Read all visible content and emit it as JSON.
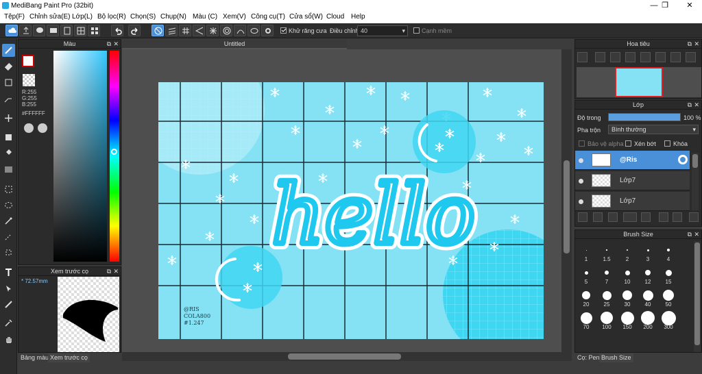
{
  "window": {
    "title": "MediBang Paint Pro (32bit)",
    "minimize": "—",
    "restore": "❐",
    "close": "✕"
  },
  "menu": [
    "Tệp(F)",
    "Chỉnh sửa(E)",
    "Lớp(L)",
    "Bộ lọc(R)",
    "Chọn(S)",
    "Chụp(N)",
    "Màu (C)",
    "Xem(V)",
    "Công cụ(T)",
    "Cửa sổ(W)",
    "Cloud",
    "Help"
  ],
  "toolbar": {
    "antialias_label": "Khử răng cưa",
    "correction_label": "Điều chỉnh",
    "correction_value": "40",
    "edge_label": "Cạnh mềm"
  },
  "color_panel": {
    "title": "Màu",
    "r": "R:255",
    "g": "G:255",
    "b": "B:255",
    "hex": "#FFFFFF",
    "fg_color": "#ffffff",
    "bg_color": "#ffffff"
  },
  "brush_preview": {
    "title": "Xem trước cọ",
    "size": "72.57mm"
  },
  "left_bottom_tabs": [
    "Bảng màu",
    "Xem trước cọ"
  ],
  "document": {
    "tab": "Untitled",
    "hello_text": "hello",
    "watermark_lines": [
      "@RIS",
      "COLA800",
      "#1.247"
    ]
  },
  "navigator": {
    "title": "Hoa tiêu"
  },
  "layers": {
    "title": "Lớp",
    "opacity_label": "Độ trong",
    "opacity_value": "100 %",
    "opacity": 1.0,
    "blend_label": "Pha trộn",
    "blend_value": "Bình thường",
    "protect_alpha": "Bảo vệ alpha",
    "clip": "Xén bớt",
    "lock": "Khóa",
    "items": [
      {
        "name": "@Ris",
        "selected": true
      },
      {
        "name": "Lớp7",
        "selected": false
      },
      {
        "name": "Lớp7",
        "selected": false
      }
    ]
  },
  "brush_size": {
    "title": "Brush Size",
    "sizes": [
      "1",
      "1.5",
      "2",
      "3",
      "4",
      "5",
      "7",
      "10",
      "12",
      "15",
      "20",
      "25",
      "30",
      "40",
      "50",
      "70",
      "100",
      "150",
      "200",
      "300"
    ]
  },
  "right_bottom_tabs": [
    "Cọ: Pen",
    "Brush Size"
  ],
  "colors": {
    "accent": "#4a90d9",
    "canvas_bg": "#84e2f4",
    "hello": "#1ec8ee"
  }
}
